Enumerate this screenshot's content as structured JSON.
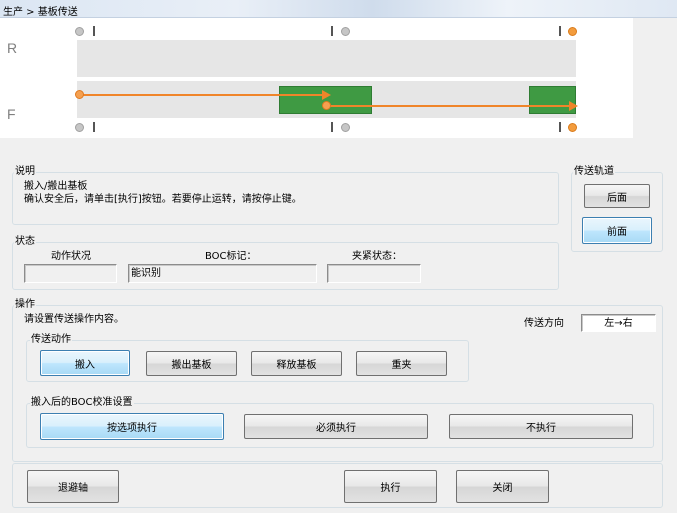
{
  "window": {
    "title": "生产 > 基板传送"
  },
  "diagram": {
    "row_r": "R",
    "row_f": "F"
  },
  "description": {
    "title": "说明",
    "line1": "搬入/搬出基板",
    "line2": "确认安全后，请单击[执行]按钮。若要停止运转，请按停止键。"
  },
  "track": {
    "title": "传送轨道",
    "rear_label": "后面",
    "front_label": "前面"
  },
  "status": {
    "title": "状态",
    "action_label": "动作状况",
    "action_value": "",
    "boc_label": "BOC标记：",
    "boc_value": "能识别",
    "clamp_label": "夹紧状态：",
    "clamp_value": ""
  },
  "operation": {
    "title": "操作",
    "prompt": "请设置传送操作内容。",
    "direction_label": "传送方向",
    "direction_value": "左→右",
    "actions": {
      "title": "传送动作",
      "load": "搬入",
      "unload": "搬出基板",
      "release": "释放基板",
      "reclamp": "重夹"
    },
    "boc": {
      "title": "搬入后的BOC校准设置",
      "by_option": "按选项执行",
      "always": "必须执行",
      "never": "不执行"
    }
  },
  "footer": {
    "retract": "退避轴",
    "execute": "执行",
    "close": "关闭"
  }
}
